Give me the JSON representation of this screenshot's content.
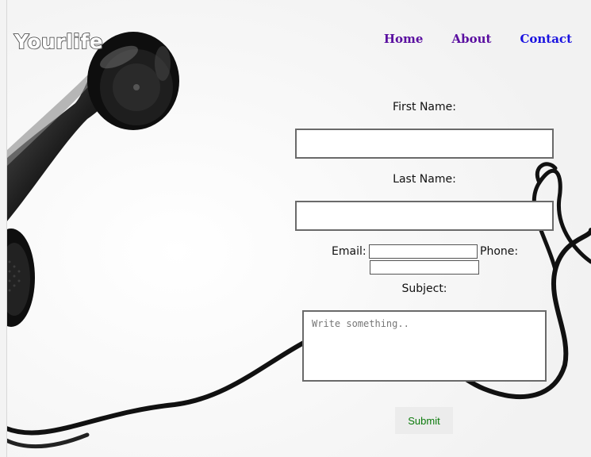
{
  "header": {
    "logo_text": "Yourlife",
    "nav": [
      {
        "label": "Home"
      },
      {
        "label": "About"
      },
      {
        "label": "Contact"
      }
    ]
  },
  "form": {
    "first_name_label": "First Name:",
    "first_name_value": "",
    "last_name_label": "Last Name:",
    "last_name_value": "",
    "email_label": "Email:",
    "email_value": "",
    "phone_label": "Phone:",
    "phone_value": "",
    "subject_label": "Subject:",
    "message_placeholder": "Write something..",
    "submit_label": "Submit"
  },
  "colors": {
    "nav_visited": "#5a0fa0",
    "nav_link": "#1a12e0",
    "submit_text": "#0b7a0b",
    "submit_bg": "#ececec"
  }
}
